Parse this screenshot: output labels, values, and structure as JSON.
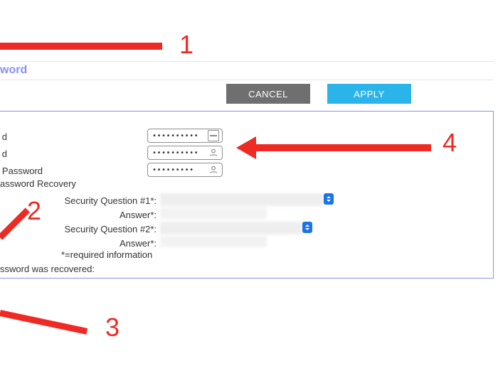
{
  "header": {
    "tab_title": "word"
  },
  "buttons": {
    "cancel": "CANCEL",
    "apply": "APPLY"
  },
  "form": {
    "current_pwd_label": "d",
    "new_pwd_label": "d",
    "confirm_pwd_label": "Password",
    "pwd_mask": "••••••••••",
    "pwd_mask_short": "•••••••••",
    "recovery_heading": "assword Recovery",
    "q1_label": "Security Question #1*:",
    "a1_label": "Answer*:",
    "q2_label": "Security Question #2*:",
    "a2_label": "Answer*:",
    "required_note": "*=required information",
    "last_recovered": "ssword was recovered:"
  },
  "callouts": {
    "n1": "1",
    "n2": "2",
    "n3": "3",
    "n4": "4"
  }
}
